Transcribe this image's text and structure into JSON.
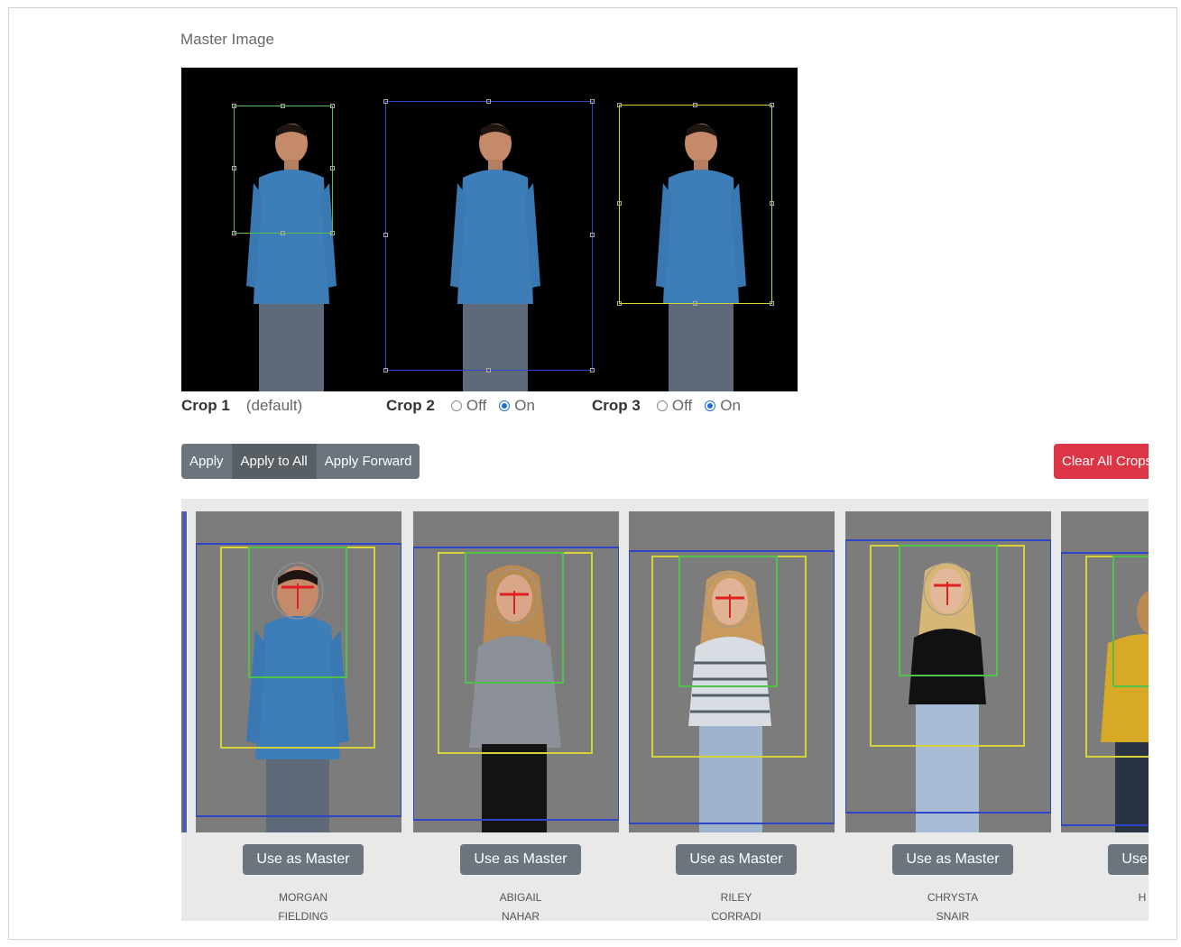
{
  "master": {
    "title": "Master Image",
    "crops": [
      {
        "label": "Crop 1",
        "note": "(default)"
      },
      {
        "label": "Crop 2",
        "off_label": "Off",
        "on_label": "On",
        "selected": "On"
      },
      {
        "label": "Crop 3",
        "off_label": "Off",
        "on_label": "On",
        "selected": "On"
      }
    ]
  },
  "actions": {
    "apply": "Apply",
    "apply_to_all": "Apply to All",
    "apply_forward": "Apply Forward",
    "clear_all": "Clear All Crops"
  },
  "students": [
    {
      "first": "MORGAN",
      "last": "FIELDING",
      "button": "Use as Master"
    },
    {
      "first": "ABIGAIL",
      "last": "NAHAR",
      "button": "Use as Master"
    },
    {
      "first": "RILEY",
      "last": "CORRADI",
      "button": "Use as Master"
    },
    {
      "first": "CHRYSTA",
      "last": "SNAIR",
      "button": "Use as Master"
    },
    {
      "first": "H",
      "last": "",
      "button": "Use as Master"
    }
  ],
  "colors": {
    "crop1": "#4fc24a",
    "crop2": "#2f45c8",
    "crop3": "#d6d23a",
    "face_marker": "#e02020",
    "danger": "#dc3545",
    "secondary": "#6c757d"
  }
}
